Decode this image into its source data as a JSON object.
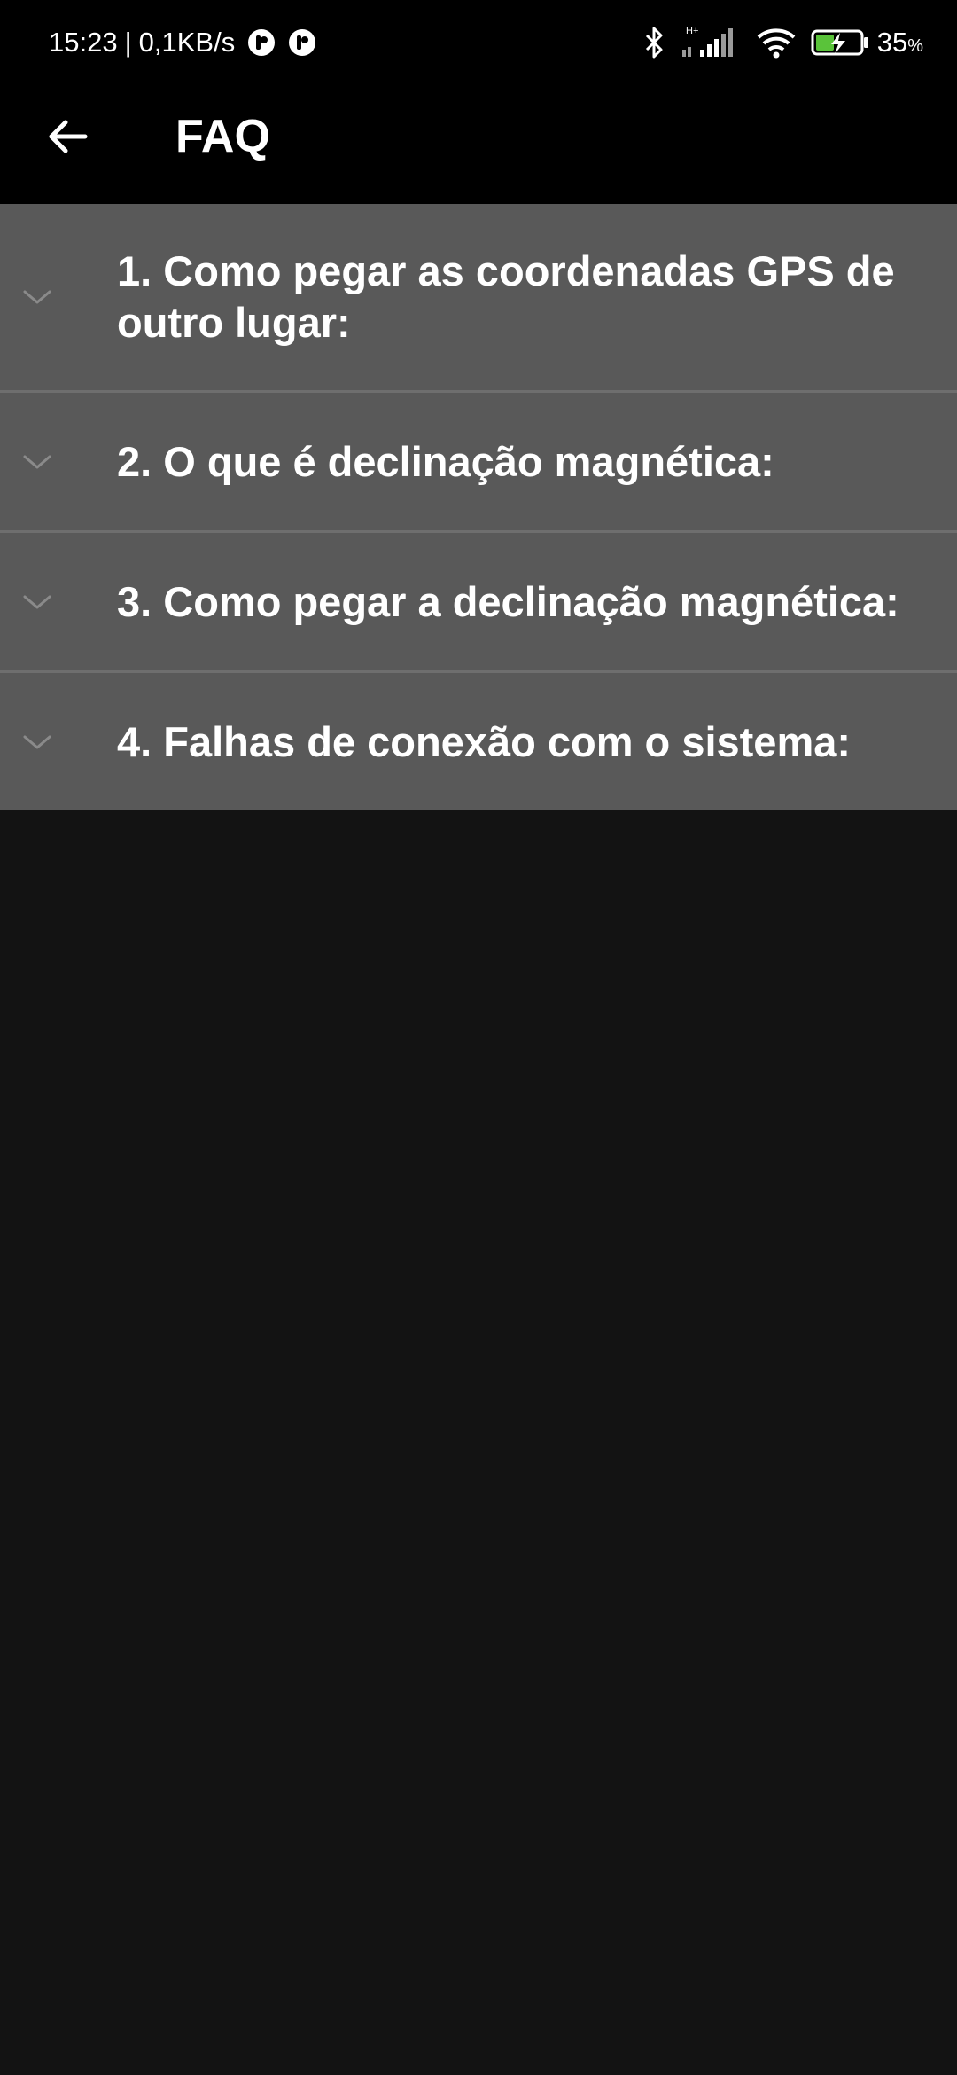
{
  "status_bar": {
    "time": "15:23",
    "separator": "|",
    "net_speed": "0,1KB/s",
    "network_type": "H+",
    "battery_value": "35",
    "battery_unit": "%",
    "icons": [
      "notification-app-icon",
      "notification-app-icon",
      "bluetooth-icon",
      "cell-signal-icon",
      "wifi-icon",
      "battery-charging-icon"
    ]
  },
  "app_bar": {
    "back_icon": "arrow-left-icon",
    "title": "FAQ"
  },
  "faq": {
    "items": [
      {
        "question": "1. Como pegar as coordenadas GPS de outro lugar:",
        "icon": "chevron-down-icon"
      },
      {
        "question": "2. O que é declinação magnética:",
        "icon": "chevron-down-icon"
      },
      {
        "question": "3. Como pegar a declinação magnética:",
        "icon": "chevron-down-icon"
      },
      {
        "question": "4. Falhas de conexão com o sistema:",
        "icon": "chevron-down-icon"
      }
    ]
  },
  "colors": {
    "status_bar_bg": "#000000",
    "app_bar_bg": "#000000",
    "page_bg": "#131313",
    "faq_item_bg": "#595959",
    "divider": "#6e6e6e",
    "chevron": "#8a8a8a",
    "battery_fill": "#5ac33a"
  }
}
